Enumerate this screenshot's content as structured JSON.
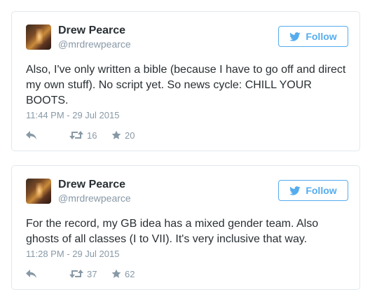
{
  "colors": {
    "accent": "#55acee",
    "muted": "#8899a6",
    "text": "#292f33",
    "border": "#e1e8ed"
  },
  "tweets": [
    {
      "name": "Drew Pearce",
      "handle": "@mrdrewpearce",
      "follow_label": "Follow",
      "text": "Also, I've only written a bible (because I have to go off and direct my own stuff). No script yet. So news cycle: CHILL YOUR BOOTS.",
      "timestamp": "11:44 PM - 29 Jul 2015",
      "retweets": "16",
      "favorites": "20",
      "icons": [
        "reply-icon",
        "retweet-icon",
        "star-icon",
        "twitter-bird-icon"
      ]
    },
    {
      "name": "Drew Pearce",
      "handle": "@mrdrewpearce",
      "follow_label": "Follow",
      "text": "For the record, my GB idea has a mixed gender team. Also ghosts of all classes (I to VII). It's very inclusive that way.",
      "timestamp": "11:28 PM - 29 Jul 2015",
      "retweets": "37",
      "favorites": "62",
      "icons": [
        "reply-icon",
        "retweet-icon",
        "star-icon",
        "twitter-bird-icon"
      ]
    }
  ]
}
